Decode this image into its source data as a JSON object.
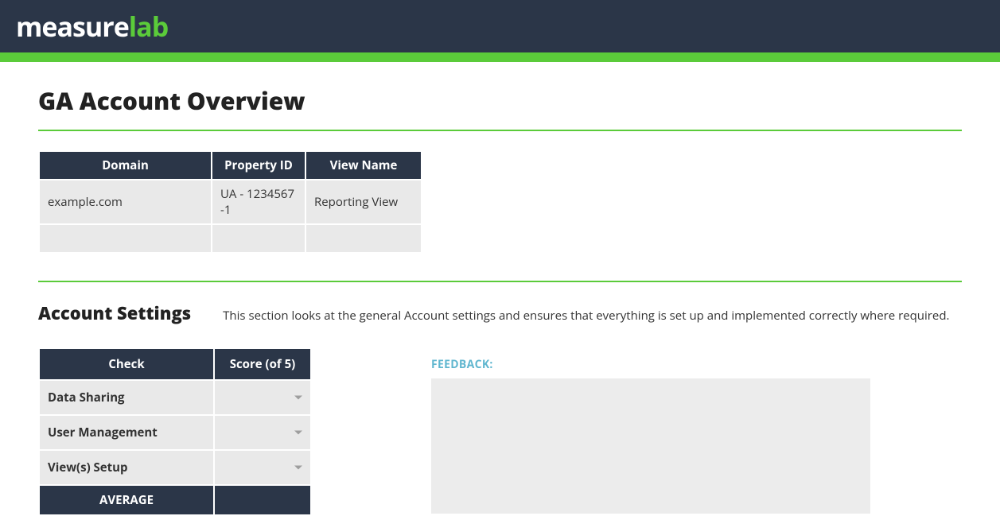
{
  "brand": {
    "part1": "measure",
    "part2": "lab"
  },
  "page_title": "GA Account Overview",
  "overview_table": {
    "headers": {
      "domain": "Domain",
      "property_id": "Property ID",
      "view_name": "View Name"
    },
    "rows": [
      {
        "domain": "example.com",
        "property_id": "UA - 1234567 -1",
        "view_name": "Reporting View"
      },
      {
        "domain": "",
        "property_id": "",
        "view_name": ""
      }
    ]
  },
  "account_settings": {
    "title": "Account Settings",
    "description": "This section looks at the general Account settings and ensures that everything is set up and implemented correctly where required.",
    "headers": {
      "check": "Check",
      "score": "Score (of 5)"
    },
    "checks": [
      {
        "name": "Data Sharing",
        "score": ""
      },
      {
        "name": "User Management",
        "score": ""
      },
      {
        "name": "View(s) Setup",
        "score": ""
      }
    ],
    "average_label": "AVERAGE",
    "average_value": ""
  },
  "feedback": {
    "label": "FEEDBACK:",
    "content": ""
  }
}
